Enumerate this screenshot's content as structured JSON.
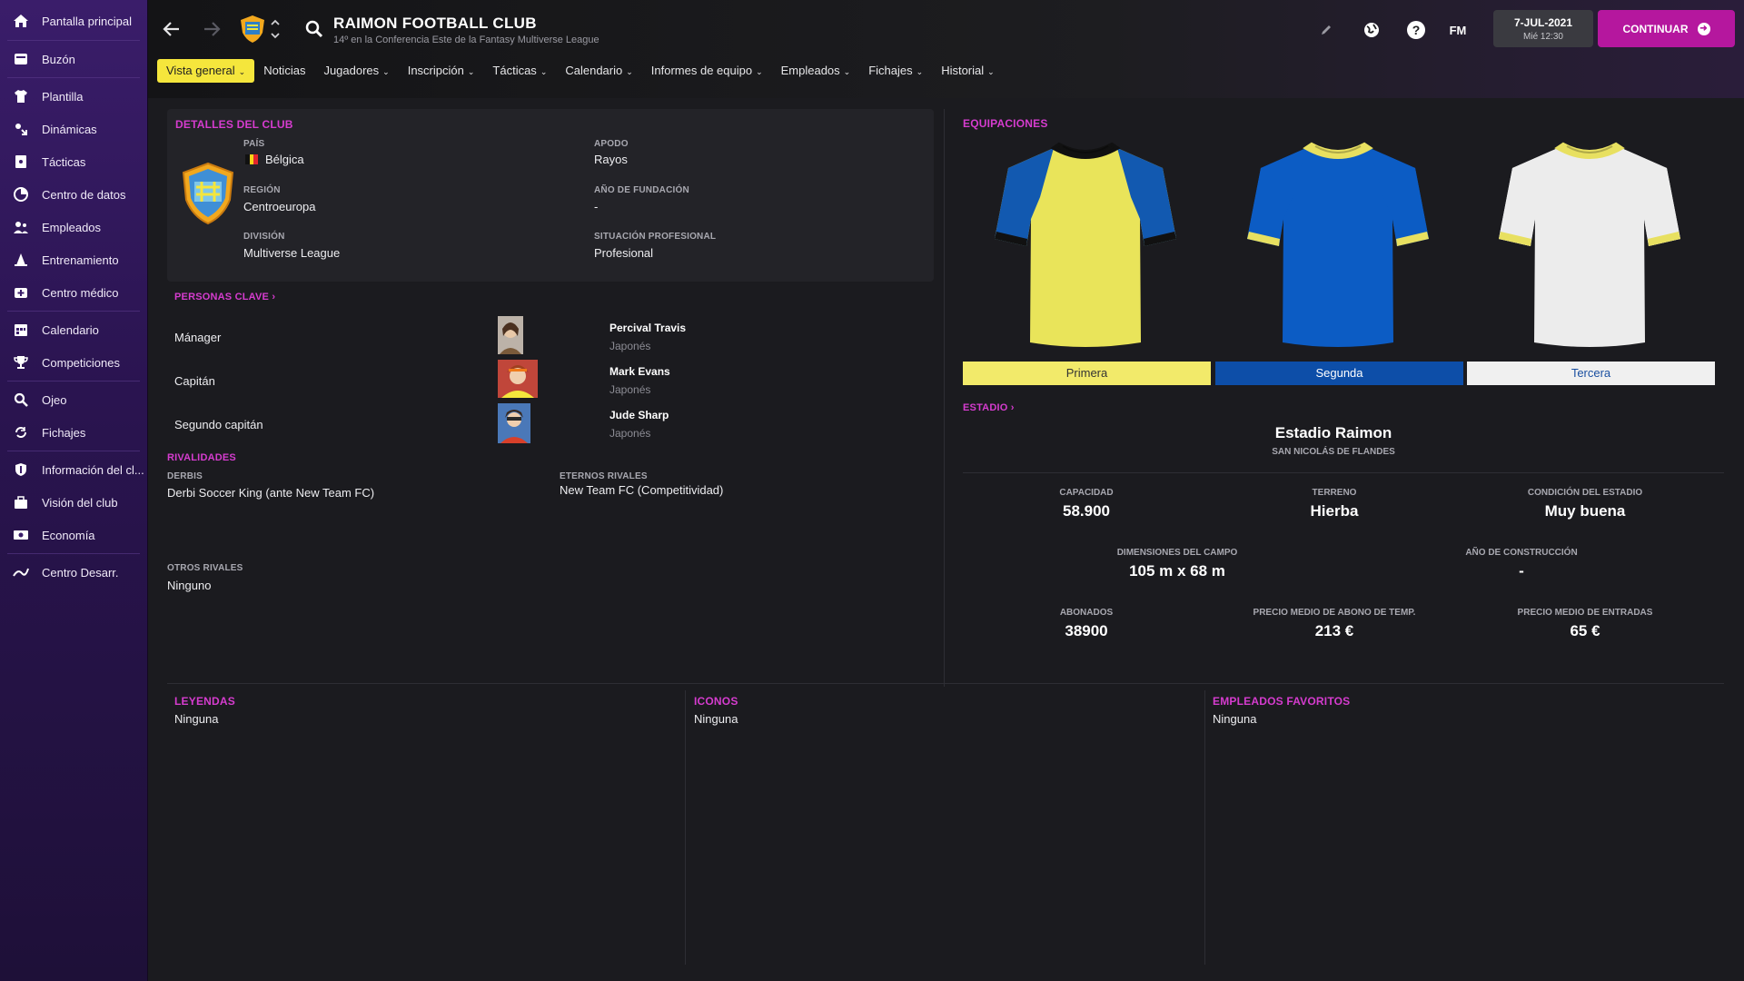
{
  "sidebar": {
    "items": [
      {
        "label": "Pantalla principal",
        "icon": "home-icon"
      },
      {
        "label": "Buzón",
        "icon": "inbox-icon"
      },
      {
        "label": "Plantilla",
        "icon": "shirt-icon"
      },
      {
        "label": "Dinámicas",
        "icon": "dynamics-icon"
      },
      {
        "label": "Tácticas",
        "icon": "tactics-icon"
      },
      {
        "label": "Centro de datos",
        "icon": "data-hub-icon"
      },
      {
        "label": "Empleados",
        "icon": "staff-icon"
      },
      {
        "label": "Entrenamiento",
        "icon": "training-cone-icon"
      },
      {
        "label": "Centro médico",
        "icon": "medical-icon"
      },
      {
        "label": "Calendario",
        "icon": "calendar-icon"
      },
      {
        "label": "Competiciones",
        "icon": "trophy-icon"
      },
      {
        "label": "Ojeo",
        "icon": "scouting-search-icon"
      },
      {
        "label": "Fichajes",
        "icon": "transfers-icon"
      },
      {
        "label": "Información del cl...",
        "icon": "club-info-shield-icon"
      },
      {
        "label": "Visión del club",
        "icon": "club-vision-icon"
      },
      {
        "label": "Economía",
        "icon": "finances-icon"
      },
      {
        "label": "Centro Desarr.",
        "icon": "development-centre-icon"
      }
    ]
  },
  "header": {
    "title": "RAIMON FOOTBALL CLUB",
    "subtitle": "14º en la Conferencia Este de la Fantasy Multiverse League",
    "fm_label": "FM",
    "date": "7-JUL-2021",
    "day_time": "Mié 12:30",
    "continue_label": "CONTINUAR"
  },
  "tabs": [
    {
      "label": "Vista general",
      "active": true,
      "dropdown": true
    },
    {
      "label": "Noticias",
      "active": false,
      "dropdown": false
    },
    {
      "label": "Jugadores",
      "active": false,
      "dropdown": true
    },
    {
      "label": "Inscripción",
      "active": false,
      "dropdown": true
    },
    {
      "label": "Tácticas",
      "active": false,
      "dropdown": true
    },
    {
      "label": "Calendario",
      "active": false,
      "dropdown": true
    },
    {
      "label": "Informes de equipo",
      "active": false,
      "dropdown": true
    },
    {
      "label": "Empleados",
      "active": false,
      "dropdown": true
    },
    {
      "label": "Fichajes",
      "active": false,
      "dropdown": true
    },
    {
      "label": "Historial",
      "active": false,
      "dropdown": true
    }
  ],
  "club_details": {
    "title": "DETALLES DEL CLUB",
    "country_label": "PAÍS",
    "country": "Bélgica",
    "region_label": "REGIÓN",
    "region": "Centroeuropa",
    "division_label": "DIVISIÓN",
    "division": "Multiverse League",
    "nickname_label": "APODO",
    "nickname": "Rayos",
    "founded_label": "AÑO DE FUNDACIÓN",
    "founded": "-",
    "status_label": "SITUACIÓN PROFESIONAL",
    "status": "Profesional"
  },
  "key_people": {
    "title": "PERSONAS CLAVE",
    "rows": [
      {
        "role": "Mánager",
        "name": "Percival Travis",
        "nationality": "Japonés"
      },
      {
        "role": "Capitán",
        "name": "Mark Evans",
        "nationality": "Japonés"
      },
      {
        "role": "Segundo capitán",
        "name": "Jude Sharp",
        "nationality": "Japonés"
      }
    ]
  },
  "rivalries": {
    "title": "RIVALIDADES",
    "derbies_label": "DERBIS",
    "derbies": "Derbi Soccer King (ante New Team FC)",
    "eternal_label": "ETERNOS RIVALES",
    "eternal": "New Team FC (Competitividad)",
    "others_label": "OTROS RIVALES",
    "others": "Ninguno"
  },
  "kits": {
    "title": "EQUIPACIONES",
    "items": [
      {
        "label": "Primera",
        "body": "#e9e45a",
        "sleeve": "#1259b0",
        "trim": "#111111",
        "label_bg": "#f2ea6a",
        "label_fg": "#333333"
      },
      {
        "label": "Segunda",
        "body": "#0c5cc4",
        "sleeve": "#0c5cc4",
        "trim": "#e8e060",
        "label_bg": "#0d4ea8",
        "label_fg": "#ffffff"
      },
      {
        "label": "Tercera",
        "body": "#ececec",
        "sleeve": "#ececec",
        "trim": "#e8e060",
        "label_bg": "#f0f0f0",
        "label_fg": "#1a4fa0"
      }
    ]
  },
  "stadium": {
    "title": "ESTADIO",
    "name": "Estadio Raimon",
    "city": "SAN NICOLÁS DE FLANDES",
    "capacity_label": "CAPACIDAD",
    "capacity": "58.900",
    "surface_label": "TERRENO",
    "surface": "Hierba",
    "condition_label": "CONDICIÓN DEL ESTADIO",
    "condition": "Muy buena",
    "dimensions_label": "DIMENSIONES DEL CAMPO",
    "dimensions": "105 m x 68 m",
    "built_label": "AÑO DE CONSTRUCCIÓN",
    "built": "-",
    "season_tickets_label": "ABONADOS",
    "season_tickets": "38900",
    "avg_season_price_label": "PRECIO MEDIO DE ABONO DE TEMP.",
    "avg_season_price": "213 €",
    "avg_ticket_label": "PRECIO MEDIO DE ENTRADAS",
    "avg_ticket": "65 €"
  },
  "bottom": {
    "legends_title": "LEYENDAS",
    "legends": "Ninguna",
    "icons_title": "ICONOS",
    "icons": "Ninguna",
    "fav_staff_title": "EMPLEADOS FAVORITOS",
    "fav_staff": "Ninguna"
  }
}
